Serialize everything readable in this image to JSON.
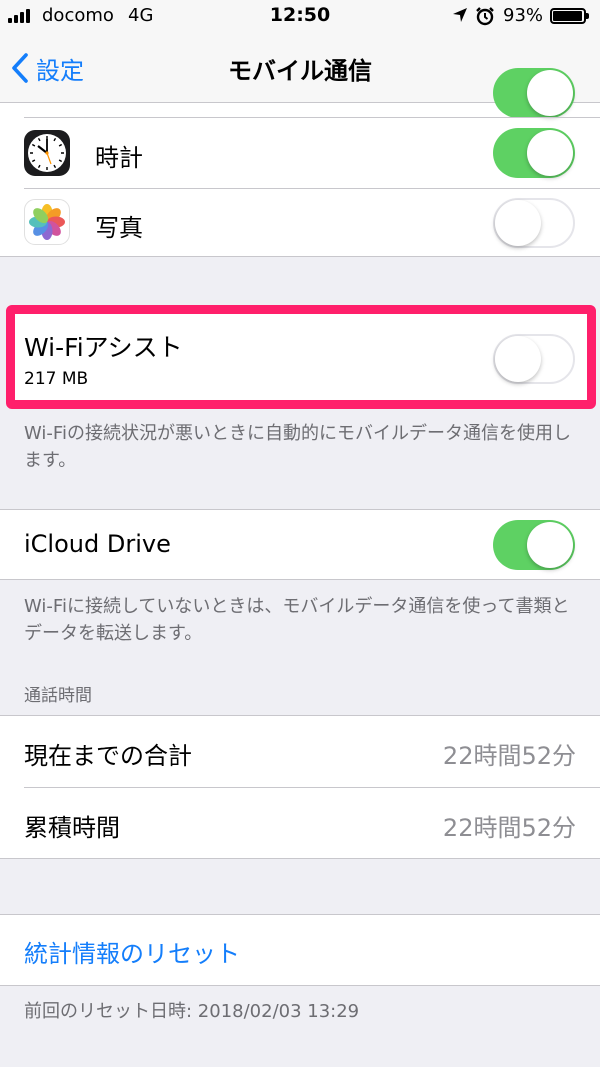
{
  "status_bar": {
    "carrier": "docomo",
    "network": "4G",
    "time": "12:50",
    "battery": "93%"
  },
  "nav": {
    "back_label": "設定",
    "title": "モバイル通信"
  },
  "apps": [
    {
      "name": "時計",
      "icon": "clock-icon",
      "enabled": true
    },
    {
      "name": "写真",
      "icon": "photos-icon",
      "enabled": false
    }
  ],
  "wifi_assist": {
    "label": "Wi-Fiアシスト",
    "usage": "217 MB",
    "enabled": false,
    "highlight_color": "#ff1f6b",
    "footer": "Wi-Fiの接続状況が悪いときに自動的にモバイルデータ通信を使用します。"
  },
  "icloud_drive": {
    "label": "iCloud Drive",
    "enabled": true,
    "footer": "Wi-Fiに接続していないときは、モバイルデータ通信を使って書類とデータを転送します。"
  },
  "call_time": {
    "header": "通話時間",
    "rows": [
      {
        "label": "現在までの合計",
        "value": "22時間52分"
      },
      {
        "label": "累積時間",
        "value": "22時間52分"
      }
    ]
  },
  "reset": {
    "label": "統計情報のリセット",
    "footer": "前回のリセット日時: 2018/02/03 13:29"
  },
  "colors": {
    "accent": "#147efb",
    "toggle_on": "#5ed163",
    "background": "#efeff4"
  }
}
